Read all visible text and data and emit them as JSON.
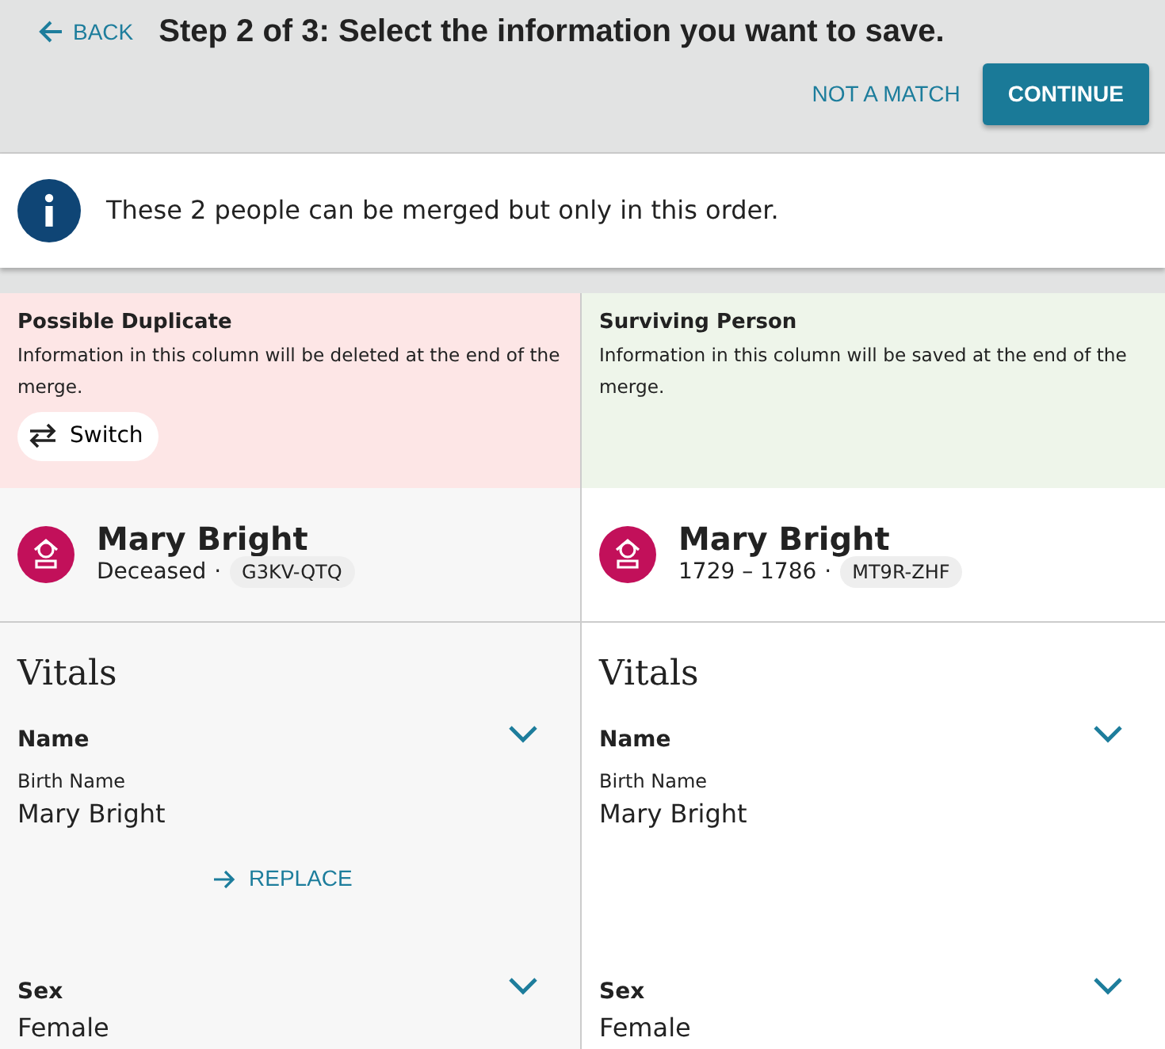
{
  "header": {
    "back": "BACK",
    "title": "Step 2 of 3: Select the information you want to save.",
    "not_match": "NOT A MATCH",
    "continue": "CONTINUE"
  },
  "notice": {
    "text": "These 2 people can be merged but only in this order."
  },
  "columns": [
    {
      "kind": "duplicate",
      "heading": "Possible Duplicate",
      "description": "Information in this column will be deleted at the end of the merge.",
      "switch": "Switch",
      "person": {
        "name": "Mary Bright",
        "lifespan": "Deceased",
        "separator": "·",
        "id": "G3KV-QTQ"
      },
      "section": "Vitals",
      "fields": [
        {
          "label": "Name",
          "sublabel": "Birth Name",
          "value": "Mary Bright",
          "action": "REPLACE"
        },
        {
          "label": "Sex",
          "value": "Female"
        }
      ]
    },
    {
      "kind": "surviving",
      "heading": "Surviving Person",
      "description": "Information in this column will be saved at the end of the merge.",
      "person": {
        "name": "Mary Bright",
        "lifespan": "1729 – 1786",
        "separator": "·",
        "id": "MT9R-ZHF"
      },
      "section": "Vitals",
      "fields": [
        {
          "label": "Name",
          "sublabel": "Birth Name",
          "value": "Mary Bright"
        },
        {
          "label": "Sex",
          "value": "Female"
        }
      ]
    }
  ]
}
